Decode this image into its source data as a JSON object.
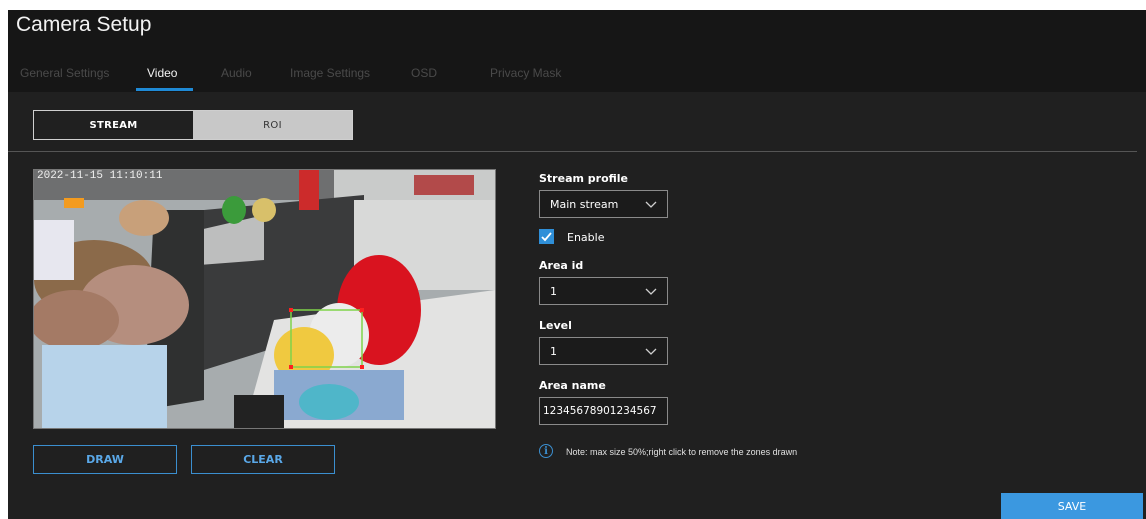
{
  "app": {
    "title": "Camera Setup"
  },
  "tabs": [
    {
      "label": "General Settings",
      "active": false
    },
    {
      "label": "Video",
      "active": true
    },
    {
      "label": "Audio",
      "active": false
    },
    {
      "label": "Image Settings",
      "active": false
    },
    {
      "label": "OSD",
      "active": false
    },
    {
      "label": "Privacy Mask",
      "active": false
    }
  ],
  "segment": {
    "stream_label": "STREAM",
    "roi_label": "ROI",
    "selected": "STREAM"
  },
  "video": {
    "timestamp": "2022-11-15 11:10:11"
  },
  "buttons": {
    "draw": "DRAW",
    "clear": "CLEAR",
    "save": "SAVE"
  },
  "form": {
    "stream_profile": {
      "label": "Stream profile",
      "value": "Main stream"
    },
    "enable": {
      "label": "Enable",
      "checked": true
    },
    "area_id": {
      "label": "Area id",
      "value": "1"
    },
    "level": {
      "label": "Level",
      "value": "1"
    },
    "area_name": {
      "label": "Area name",
      "value": "12345678901234567"
    }
  },
  "note": "Note: max size 50%;right click to remove the zones drawn",
  "colors": {
    "accent": "#3b98e0",
    "background": "#202020",
    "header": "#161616"
  }
}
